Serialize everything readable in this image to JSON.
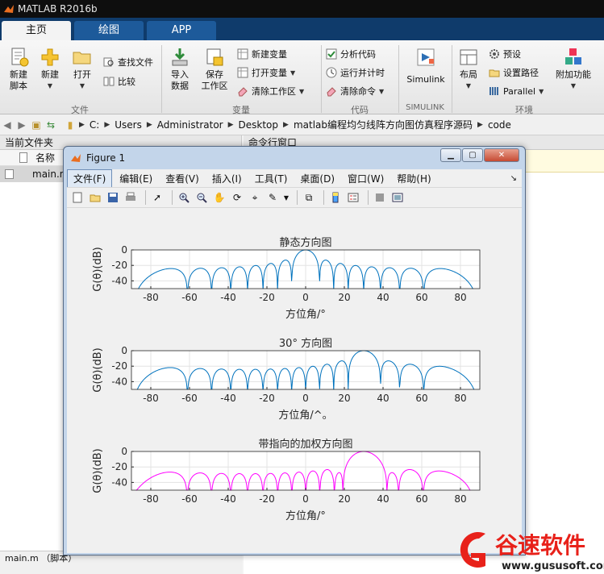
{
  "window": {
    "title": "MATLAB R2016b"
  },
  "tabs": [
    {
      "label": "主页",
      "active": true
    },
    {
      "label": "绘图",
      "active": false
    },
    {
      "label": "APP",
      "active": false
    }
  ],
  "ribbon": {
    "file": {
      "new_script": "新建\n脚本",
      "new": "新建",
      "open": "打开",
      "find_files": "查找文件",
      "compare": "比较",
      "section": "文件"
    },
    "variable": {
      "import": "导入\n数据",
      "save_workspace": "保存\n工作区",
      "new_variable": "新建变量",
      "open_variable": "打开变量",
      "clear_workspace": "清除工作区",
      "section": "变量"
    },
    "code": {
      "analyze": "分析代码",
      "run_time": "运行并计时",
      "clear_commands": "清除命令",
      "section": "代码"
    },
    "simulink": {
      "label": "Simulink",
      "section": "SIMULINK"
    },
    "env": {
      "layout": "布局",
      "preferences": "预设",
      "set_path": "设置路径",
      "parallel": "Parallel",
      "addons": "附加功能",
      "section": "环境"
    }
  },
  "address": {
    "crumbs": [
      "C:",
      "Users",
      "Administrator",
      "Desktop",
      "matlab编程均匀线阵方向图仿真程序源码",
      "code"
    ]
  },
  "left_panel": {
    "title": "当前文件夹",
    "column_name": "名称",
    "file": "main.m",
    "bottom": "main.m （脚本）"
  },
  "command_window": {
    "title": "命令行窗口"
  },
  "figure": {
    "title": "Figure 1",
    "menu": [
      "文件(F)",
      "编辑(E)",
      "查看(V)",
      "插入(I)",
      "工具(T)",
      "桌面(D)",
      "窗口(W)",
      "帮助(H)"
    ]
  },
  "chart_data": [
    {
      "type": "line",
      "title": "静态方向图",
      "xlabel": "方位角/°",
      "ylabel": "G(θ)(dB)",
      "xlim": [
        -90,
        90
      ],
      "ylim": [
        -50,
        0
      ],
      "xticks": [
        "-80",
        "-60",
        "-40",
        "-20",
        "0",
        "20",
        "40",
        "60",
        "80"
      ],
      "yticks": [
        "0",
        "-20",
        "-40"
      ],
      "grid": true,
      "color": "#0072bd",
      "series": [
        {
          "elements": 16,
          "steer_deg": 0,
          "taper": "uniform"
        }
      ]
    },
    {
      "type": "line",
      "title": "30° 方向图",
      "xlabel": "方位角/^。",
      "ylabel": "G(θ)(dB)",
      "xlim": [
        -90,
        90
      ],
      "ylim": [
        -50,
        0
      ],
      "xticks": [
        "-80",
        "-60",
        "-40",
        "-20",
        "0",
        "20",
        "40",
        "60",
        "80"
      ],
      "yticks": [
        "0",
        "-20",
        "-40"
      ],
      "grid": true,
      "color": "#0072bd",
      "series": [
        {
          "elements": 16,
          "steer_deg": 30,
          "taper": "uniform"
        }
      ]
    },
    {
      "type": "line",
      "title": "带指向的加权方向图",
      "xlabel": "方位角/°",
      "ylabel": "G(θ)(dB)",
      "xlim": [
        -90,
        90
      ],
      "ylim": [
        -50,
        0
      ],
      "xticks": [
        "-80",
        "-60",
        "-40",
        "-20",
        "0",
        "20",
        "40",
        "60",
        "80"
      ],
      "yticks": [
        "0",
        "-20",
        "-40"
      ],
      "grid": true,
      "color": "#ff00ff",
      "series": [
        {
          "elements": 16,
          "steer_deg": 30,
          "taper": "weighted"
        }
      ]
    }
  ],
  "watermark": {
    "brand": "谷速软件",
    "url": "www.gususoft.com",
    "color": "#e8211a"
  }
}
